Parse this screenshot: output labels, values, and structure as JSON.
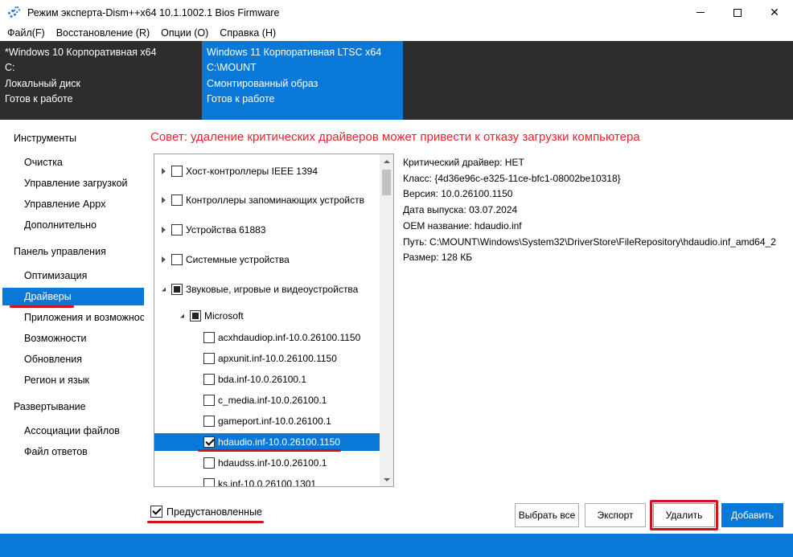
{
  "window": {
    "title": "Режим эксперта-Dism++x64 10.1.1002.1 Bios Firmware",
    "minimize": "",
    "maximize": "",
    "close": "✕"
  },
  "menu": [
    "Файл(F)",
    "Восстановление (R)",
    "Опции (O)",
    "Справка (H)"
  ],
  "images": [
    {
      "name": "*Windows 10 Корпоративная x64",
      "path": "C:",
      "type": "Локальный диск",
      "status": "Готов к работе"
    },
    {
      "name": "Windows 11 Корпоративная LTSC x64",
      "path": "C:\\MOUNT",
      "type": "Смонтированный образ",
      "status": "Готов к работе"
    }
  ],
  "sidebar": {
    "sections": [
      {
        "header": "Инструменты",
        "items": [
          "Очистка",
          "Управление загрузкой",
          "Управление Appx",
          "Дополнительно"
        ]
      },
      {
        "header": "Панель управления",
        "items": [
          "Оптимизация",
          "Драйверы",
          "Приложения и возможности",
          "Возможности",
          "Обновления",
          "Регион и язык"
        ]
      },
      {
        "header": "Развертывание",
        "items": [
          "Ассоциации файлов",
          "Файл ответов"
        ]
      }
    ],
    "active": "Драйверы"
  },
  "advice": "Совет: удаление критических драйверов может привести к отказу загрузки компьютера",
  "tree": {
    "categories": [
      "Хост-контроллеры IEEE 1394",
      "Контроллеры запоминающих устройств",
      "Устройства 61883",
      "Системные устройства",
      "Звуковые, игровые и видеоустройства"
    ],
    "vendor": "Microsoft",
    "drivers": [
      "acxhdaudiop.inf-10.0.26100.1150",
      "apxunit.inf-10.0.26100.1150",
      "bda.inf-10.0.26100.1",
      "c_media.inf-10.0.26100.1",
      "gameport.inf-10.0.26100.1",
      "hdaudio.inf-10.0.26100.1150",
      "hdaudss.inf-10.0.26100.1",
      "ks.inf-10.0.26100.1301"
    ],
    "selected": "hdaudio.inf-10.0.26100.1150"
  },
  "details": [
    "Критический драйвер: НЕТ",
    "Класс: {4d36e96c-e325-11ce-bfc1-08002be10318}",
    "Версия: 10.0.26100.1150",
    "Дата выпуска: 03.07.2024",
    "OEM название: hdaudio.inf",
    "Путь: C:\\MOUNT\\Windows\\System32\\DriverStore\\FileRepository\\hdaudio.inf_amd64_2",
    "Размер: 128 КБ"
  ],
  "footer": {
    "preinstalled": "Предустановленные",
    "select_all": "Выбрать все",
    "export": "Экспорт",
    "delete": "Удалить",
    "add": "Добавить"
  },
  "colors": {
    "accent": "#0a78d7",
    "warning": "#e3262b",
    "annotation": "#d4101a",
    "dark_panel": "#2d2d2d"
  }
}
